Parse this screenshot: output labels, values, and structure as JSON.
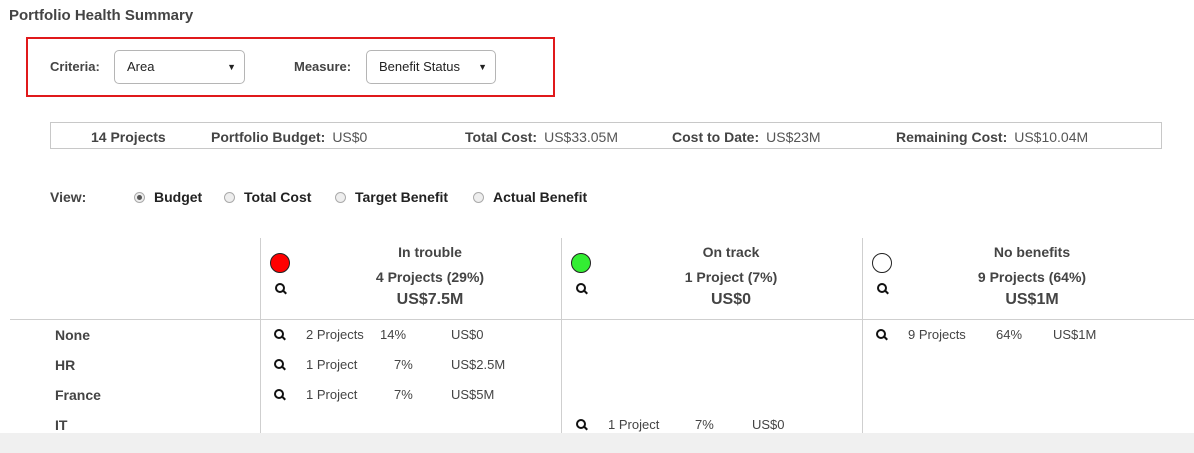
{
  "page_title": "Portfolio Health Summary",
  "filters": {
    "criteria_label": "Criteria:",
    "criteria_value": "Area",
    "measure_label": "Measure:",
    "measure_value": "Benefit Status"
  },
  "summary": {
    "projects": "14 Projects",
    "budget_label": "Portfolio Budget:",
    "budget_value": "US$0",
    "total_cost_label": "Total Cost:",
    "total_cost_value": "US$33.05M",
    "cost_to_date_label": "Cost to Date:",
    "cost_to_date_value": "US$23M",
    "remaining_label": "Remaining Cost:",
    "remaining_value": "US$10.04M"
  },
  "view": {
    "label": "View:",
    "options": [
      "Budget",
      "Total Cost",
      "Target Benefit",
      "Actual Benefit"
    ],
    "selected": "Budget"
  },
  "columns": [
    {
      "name": "In trouble",
      "count": "4 Projects (29%)",
      "amount": "US$7.5M",
      "color": "#ff0000"
    },
    {
      "name": "On track",
      "count": "1 Project (7%)",
      "amount": "US$0",
      "color": "#33ee33"
    },
    {
      "name": "No benefits",
      "count": "9 Projects (64%)",
      "amount": "US$1M",
      "color": "#ffffff"
    }
  ],
  "rows": [
    {
      "label": "None",
      "cells": [
        {
          "projects": "2 Projects",
          "pct": "14%",
          "amount": "US$0"
        },
        null,
        {
          "projects": "9 Projects",
          "pct": "64%",
          "amount": "US$1M"
        }
      ]
    },
    {
      "label": "HR",
      "cells": [
        {
          "projects": "1 Project",
          "pct": "7%",
          "amount": "US$2.5M"
        },
        null,
        null
      ]
    },
    {
      "label": "France",
      "cells": [
        {
          "projects": "1 Project",
          "pct": "7%",
          "amount": "US$5M"
        },
        null,
        null
      ]
    },
    {
      "label": "IT",
      "cells": [
        null,
        {
          "projects": "1 Project",
          "pct": "7%",
          "amount": "US$0"
        },
        null
      ]
    }
  ]
}
